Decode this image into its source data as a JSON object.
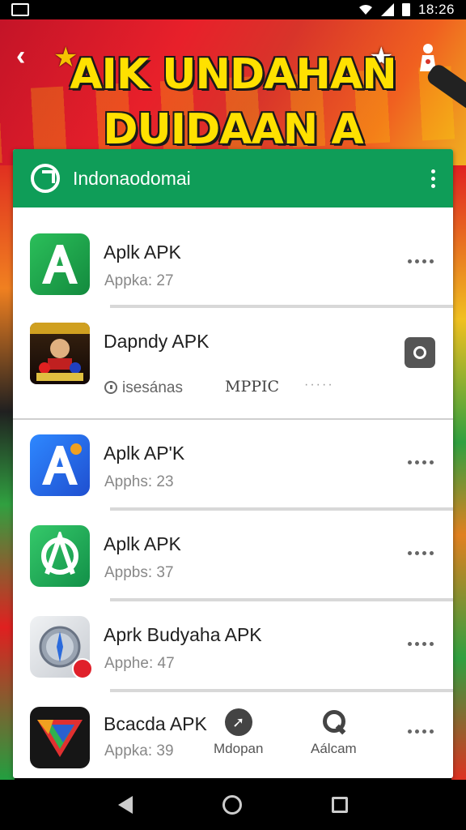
{
  "status_bar": {
    "time": "18:26"
  },
  "banner": {
    "title_line1": "AIK UNDAHAN",
    "title_line2": "DUIDAAN A NDOMIESIA",
    "back_symbol": "‹",
    "star_symbol": "★"
  },
  "header": {
    "title": "Indonaodomai"
  },
  "apps": [
    {
      "name": "Aplk APK",
      "subtitle": "Appka: 27",
      "icon": "green-a-icon",
      "color": "#1fa84f"
    },
    {
      "name": "Dapndy APK",
      "subtitle": "isesánas",
      "extra": "MPPIC",
      "extra_dots": "·····",
      "icon": "game-poster-icon",
      "color": "#2a1a0a"
    },
    {
      "name": "Aplk AP'K",
      "subtitle": "Apphs: 23",
      "icon": "blue-a-icon",
      "color": "#2f6de0"
    },
    {
      "name": "Aplk APK",
      "subtitle": "Appbs: 37",
      "icon": "green-compass-icon",
      "color": "#1fb35a"
    },
    {
      "name": "Aprk Budyaha APK",
      "subtitle": "Apphe: 47",
      "icon": "safari-compass-icon",
      "color": "#d8dde2"
    },
    {
      "name": "Bcacda APK",
      "subtitle": "Appka: 39",
      "icon": "prism-triangle-icon",
      "color": "#161616"
    }
  ],
  "last_row_tools": [
    {
      "label": "Mdopan",
      "icon": "share-icon"
    },
    {
      "label": "Aálcam",
      "icon": "search-icon"
    }
  ]
}
